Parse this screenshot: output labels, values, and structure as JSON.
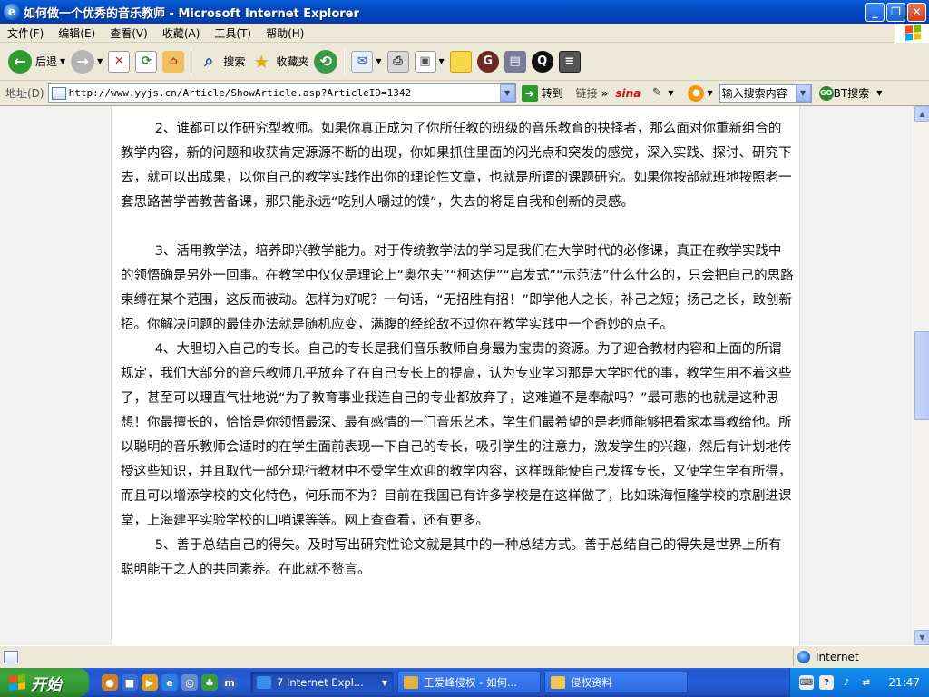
{
  "window": {
    "title": "如何做一个优秀的音乐教师 - Microsoft Internet Explorer",
    "minimize": "_",
    "maximize": "❐",
    "close": "✕"
  },
  "menu": [
    "文件(F)",
    "编辑(E)",
    "查看(V)",
    "收藏(A)",
    "工具(T)",
    "帮助(H)"
  ],
  "toolbar": {
    "back": "后退",
    "search": "搜索",
    "favorites": "收藏夹"
  },
  "address": {
    "label": "地址(D)",
    "url": "http://www.yyjs.cn/Article/ShowArticle.asp?ArticleID=1342",
    "go": "转到",
    "links": "链接",
    "links_more": "»",
    "sina": "sina",
    "search_placeholder": "输入搜索内容",
    "bt_search": "BT搜索"
  },
  "article": {
    "paragraphs": [
      "2、谁都可以作研究型教师。如果你真正成为了你所任教的班级的音乐教育的抉择者，那么面对你重新组合的教学内容，新的问题和收获肯定源源不断的出现，你如果抓住里面的闪光点和突发的感觉，深入实践、探讨、研究下去，就可以出成果，以你自己的教学实践作出你的理论性文章，也就是所谓的课题研究。如果你按部就班地按照老一套思路苦学苦教苦备课，那只能永远“吃别人嚼过的馍”，失去的将是自我和创新的灵感。",
      "3、活用教学法，培养即兴教学能力。对于传统教学法的学习是我们在大学时代的必修课，真正在教学实践中的领悟确是另外一回事。在教学中仅仅是理论上“奥尔夫”“柯达伊”“启发式”“示范法”什么什么的，只会把自己的思路束缚在某个范围，这反而被动。怎样为好呢？一句话，“无招胜有招！”即学他人之长，补己之短；扬己之长，敢创新招。你解决问题的最佳办法就是随机应变，满腹的经纶敌不过你在教学实践中一个奇妙的点子。",
      "4、大胆切入自己的专长。自己的专长是我们音乐教师自身最为宝贵的资源。为了迎合教材内容和上面的所谓规定，我们大部分的音乐教师几乎放弃了在自己专长上的提高，认为专业学习那是大学时代的事，教学生用不着这些了，甚至可以理直气壮地说“为了教育事业我连自己的专业都放弃了，这难道不是奉献吗？”最可悲的也就是这种思想！你最擅长的，恰恰是你领悟最深、最有感情的一门音乐艺术，学生们最希望的是老师能够把看家本事教给他。所以聪明的音乐教师会适时的在学生面前表现一下自己的专长，吸引学生的注意力，激发学生的兴趣，然后有计划地传授这些知识，并且取代一部分现行教材中不受学生欢迎的教学内容，这样既能使自己发挥专长，又使学生学有所得，而且可以增添学校的文化特色，何乐而不为？目前在我国已有许多学校是在这样做了，比如珠海恒隆学校的京剧进课堂，上海建平实验学校的口哨课等等。网上查查看，还有更多。",
      "5、善于总结自己的得失。及时写出研究性论文就是其中的一种总结方式。善于总结自己的得失是世界上所有聪明能干之人的共同素养。在此就不赘言。"
    ]
  },
  "status": {
    "zone": "Internet"
  },
  "taskbar": {
    "start": "开始",
    "tasks": [
      {
        "label": "7 Internet Expl...",
        "color": "#3b8ee8"
      },
      {
        "label": "王爱峰侵权 - 如何...",
        "color": "#e2b23a"
      },
      {
        "label": "侵权资料",
        "color": "#f2c94c"
      }
    ],
    "clock": "21:47"
  },
  "colors": {
    "accent": "#0a5fd8",
    "start": "#3aa83a"
  }
}
